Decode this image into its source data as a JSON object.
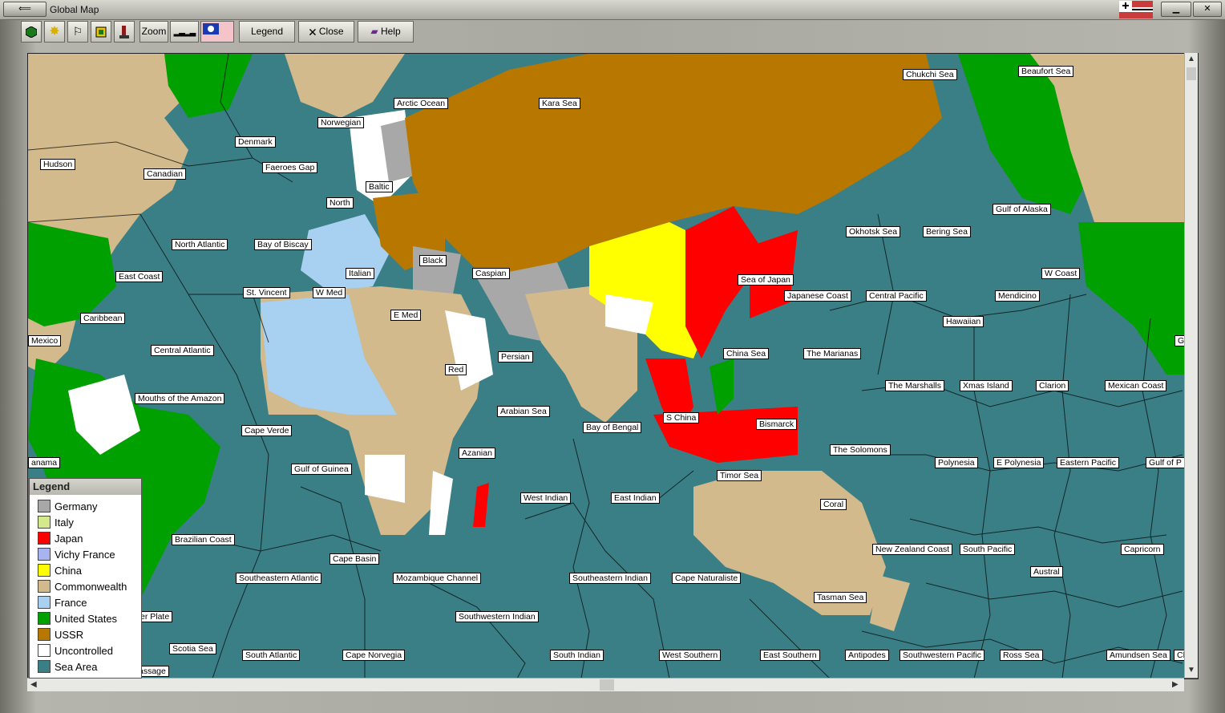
{
  "window": {
    "title": "Global Map"
  },
  "toolbar": {
    "zoom_label": "Zoom",
    "legend_label": "Legend",
    "close_label": "Close",
    "help_label": "Help"
  },
  "legend": {
    "title": "Legend",
    "items": [
      {
        "name": "Germany",
        "color": "#a8a8a8"
      },
      {
        "name": "Italy",
        "color": "#d4e88c"
      },
      {
        "name": "Japan",
        "color": "#ff0000"
      },
      {
        "name": "Vichy France",
        "color": "#a8b4f0"
      },
      {
        "name": "China",
        "color": "#ffff00"
      },
      {
        "name": "Commonwealth",
        "color": "#d2ba8c"
      },
      {
        "name": "France",
        "color": "#a8d0f0"
      },
      {
        "name": "United States",
        "color": "#00a000"
      },
      {
        "name": "USSR",
        "color": "#b87800"
      },
      {
        "name": "Uncontrolled",
        "color": "#ffffff"
      },
      {
        "name": "Sea Area",
        "color": "#3a7f86"
      }
    ]
  },
  "sea_labels": [
    "Arctic Ocean",
    "Kara Sea",
    "Chukchi Sea",
    "Beaufort Sea",
    "Norwegian",
    "Denmark",
    "Hudson",
    "Canadian",
    "Faeroes Gap",
    "Baltic",
    "North",
    "North Atlantic",
    "Bay of Biscay",
    "Black",
    "Caspian",
    "Italian",
    "East Coast",
    "St. Vincent",
    "W Med",
    "E Med",
    "Caribbean",
    "Mexico",
    "Central Atlantic",
    "Persian",
    "Red",
    "Mouths of the Amazon",
    "Cape Verde",
    "Arabian Sea",
    "Bay of Bengal",
    "S China",
    "Azanian",
    "Gulf of Guinea",
    "anama",
    "West Indian",
    "East Indian",
    "Timor Sea",
    "Bismarck",
    "The Solomons",
    "Sea of Japan",
    "Japanese Coast",
    "Central Pacific",
    "Okhotsk Sea",
    "Bering Sea",
    "Gulf of Alaska",
    "W Coast",
    "Mendicino",
    "Hawaiian",
    "China Sea",
    "The Marianas",
    "The Marshalls",
    "Xmas Island",
    "Clarion",
    "Mexican Coast",
    "Polynesia",
    "E Polynesia",
    "Eastern Pacific",
    "Gulf of P",
    "Coral",
    "New Zealand Coast",
    "South Pacific",
    "Capricorn",
    "Austral",
    "Brazilian Coast",
    "Cape Basin",
    "Southeastern Atlantic",
    "Mozambique Channel",
    "Southeastern Indian",
    "Cape Naturaliste",
    "Tasman Sea",
    "er Plate",
    "Scotia Sea",
    "Southwestern Indian",
    "South Atlantic",
    "Cape Norvegia",
    "South Indian",
    "West Southern",
    "East Southern",
    "Antipodes",
    "Southwestern Pacific",
    "Ross Sea",
    "Amundsen Sea",
    "Ch",
    "assage",
    "G"
  ]
}
